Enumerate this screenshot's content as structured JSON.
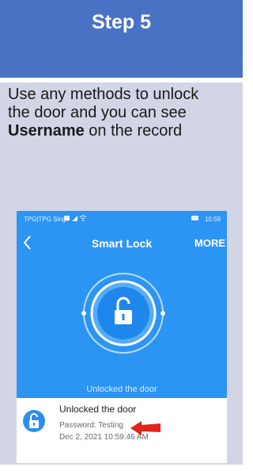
{
  "header": {
    "title": "Step 5"
  },
  "instruction": {
    "line1": "Use any methods to unlock",
    "line2": "the door and you can see",
    "bold": "Username",
    "rest": " on the record"
  },
  "phone": {
    "status_left": "TPG|TPG Sing.. ",
    "status_right": "10:59",
    "title": "Smart Lock",
    "more": "MORE",
    "lock_caption": "Unlocked the door",
    "record": {
      "title": "Unlocked the door",
      "password": "Password: Testing",
      "datetime": "Dec 2, 2021 10:59:46 AM"
    }
  },
  "colors": {
    "header": "#4a72c4",
    "panel": "#d2d5e6",
    "app_blue": "#2c95f4",
    "arrow": "#e0241a"
  },
  "icons": [
    "back-icon",
    "unlock-icon",
    "padlock-icon",
    "arrow-icon",
    "battery-icon",
    "wifi-icon",
    "signal-icon"
  ]
}
